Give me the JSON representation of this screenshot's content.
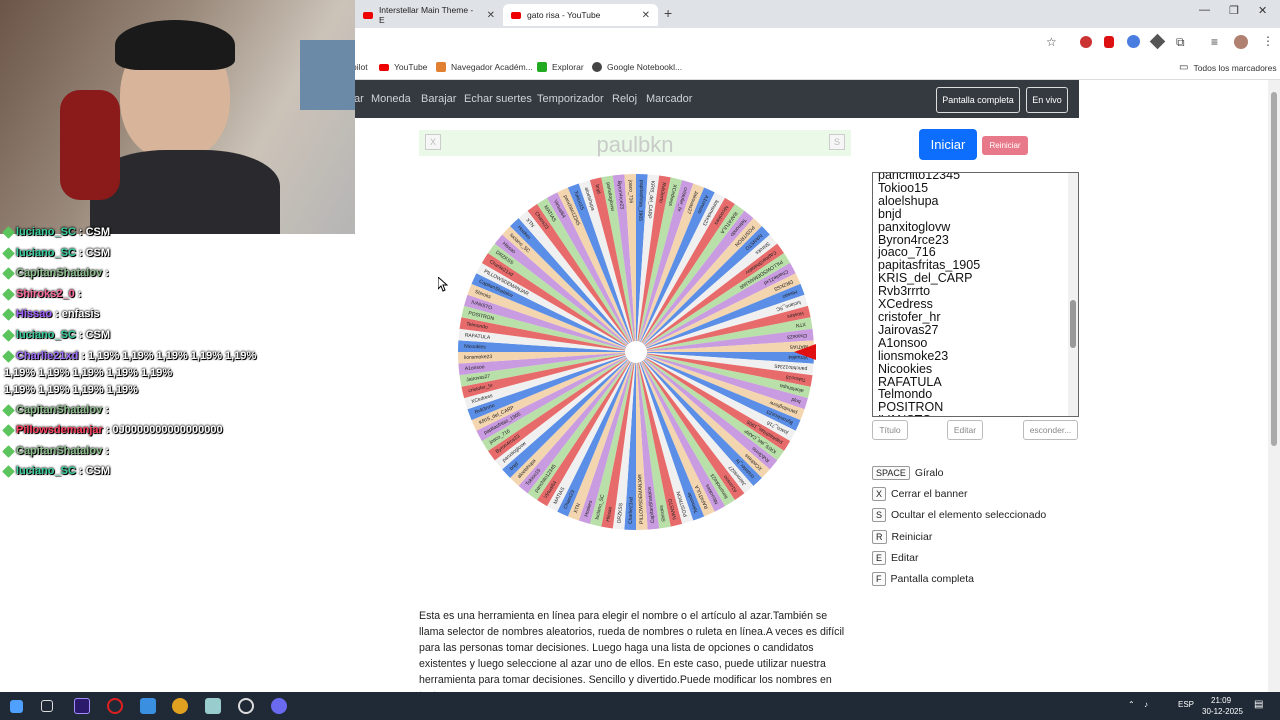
{
  "browser": {
    "tabs": [
      {
        "title": "Interstellar Main Theme - E",
        "close": "✕"
      },
      {
        "title": "gato risa - YouTube",
        "close": "✕"
      }
    ],
    "new_tab": "+",
    "bookmarks": [
      {
        "label": "pilot"
      },
      {
        "label": "YouTube"
      },
      {
        "label": "Navegador Académ..."
      },
      {
        "label": "Explorar"
      },
      {
        "label": "Google Notebookl..."
      }
    ],
    "all_bookmarks": "Todos los marcadores"
  },
  "navbar": {
    "links": [
      "ar",
      "Moneda",
      "Barajar",
      "Echar suertes",
      "Temporizador",
      "Reloj",
      "Marcador"
    ],
    "fullscreen": "Pantalla completa",
    "live": "En vivo"
  },
  "banner": {
    "title": "paulbkn",
    "close_key": "X",
    "hide_key": "S"
  },
  "actions": {
    "start": "Iniciar",
    "reset": "Reiniciar"
  },
  "names_list": [
    "panchito12345",
    "Tokioo15",
    "aloelshupa",
    "bnjd",
    "panxitoglovw",
    "Byron4rce23",
    "joaco_716",
    "papitasfritas_1905",
    "KRIS_del_CARP",
    "Rvb3rrrto",
    "XCedress",
    "cristofer_hr",
    "Jairovas27",
    "A1onsoo",
    "lionsmoke23",
    "Nicookies",
    "RAFATULA",
    "Telmondo",
    "POSITRON",
    "IVANSTO"
  ],
  "list_buttons": {
    "title": "Título",
    "edit": "Editar",
    "hide": "esconder..."
  },
  "shortcuts": [
    {
      "key": "SPACE",
      "label": "Gíralo"
    },
    {
      "key": "X",
      "label": "Cerrar el banner"
    },
    {
      "key": "S",
      "label": "Ocultar el elemento seleccionado"
    },
    {
      "key": "R",
      "label": "Reiniciar"
    },
    {
      "key": "E",
      "label": "Editar"
    },
    {
      "key": "F",
      "label": "Pantalla completa"
    }
  ],
  "description": "Esta es una herramienta en línea para elegir el nombre o el artículo al azar.También se llama selector de nombres aleatorios, rueda de nombres o ruleta en línea.A veces es difícil para las personas tomar decisiones. Luego haga una lista de opciones o candidatos existentes y luego seleccione al azar uno de ellos. En este caso, puede utilizar nuestra herramienta para tomar decisiones. Sencillo y divertido.Puede modificar los nombres en textarea, poner un",
  "wheel": {
    "colors": [
      "#5b8ee6",
      "#f0f0f0",
      "#e86b6b",
      "#b8e0a8",
      "#c99be0",
      "#f3d5b0"
    ],
    "pointer_color": "#e01010",
    "segment_labels": [
      "Virtual64",
      "panchito12345",
      "Tokioo15",
      "aloelshupa",
      "bnjd",
      "panxitoglovw",
      "Byron4rce23",
      "joaco_716",
      "papitasfritas_1905",
      "KRIS_del_CARP",
      "Rvb3rrrto",
      "XCedress",
      "cristofer_hr",
      "Jairovas27",
      "A1onsoo",
      "lionsmoke23",
      "Nicookies",
      "RAFATULA",
      "Telmondo",
      "POSITRON",
      "IVANSTO",
      "Shiroks",
      "CapitanShatalov",
      "PILLOWSDEMANJAR",
      "Charlie21xd",
      "DRZKSS",
      "Hissao",
      "luciano_SC",
      "Hoskes",
      "XTN",
      "Chaos23",
      "MATIAS"
    ]
  },
  "chat": [
    {
      "user": "luciano_SC",
      "msg": "CSM",
      "color": "#3ad0a0"
    },
    {
      "user": "luciano_SC",
      "msg": "CSM",
      "color": "#3ad0a0"
    },
    {
      "user": "CapitanShatalov",
      "msg": "",
      "color": "#8fbf8f"
    },
    {
      "user": "Shiroks2_0",
      "msg": "",
      "color": "#ff6b9e"
    },
    {
      "user": "Hissao",
      "msg": "enfasis",
      "color": "#a060ff"
    },
    {
      "user": "luciano_SC",
      "msg": "CSM",
      "color": "#3ad0a0"
    },
    {
      "user": "Charlie21xd",
      "msg": "1,19%  1,19%  1,19%  1,19%  1,19%",
      "color": "#a070ff"
    },
    {
      "user": "",
      "msg": "1,19%  1,19%  1,19%  1,19%  1,19%",
      "color": "#fff"
    },
    {
      "user": "",
      "msg": "1,19%  1,19%  1,19%  1,19%",
      "color": "#fff"
    },
    {
      "user": "CapitanShatalov",
      "msg": "",
      "color": "#8fbf8f"
    },
    {
      "user": "Pillowsdemanjar",
      "msg": "0J0000000000000000",
      "color": "#ff4060"
    },
    {
      "user": "CapitanShatalov",
      "msg": "",
      "color": "#8fbf8f"
    },
    {
      "user": "luciano_SC",
      "msg": "CSM",
      "color": "#3ad0a0"
    }
  ],
  "taskbar": {
    "lang": "ESP",
    "time": "21:09",
    "date": "30-12-2025"
  }
}
